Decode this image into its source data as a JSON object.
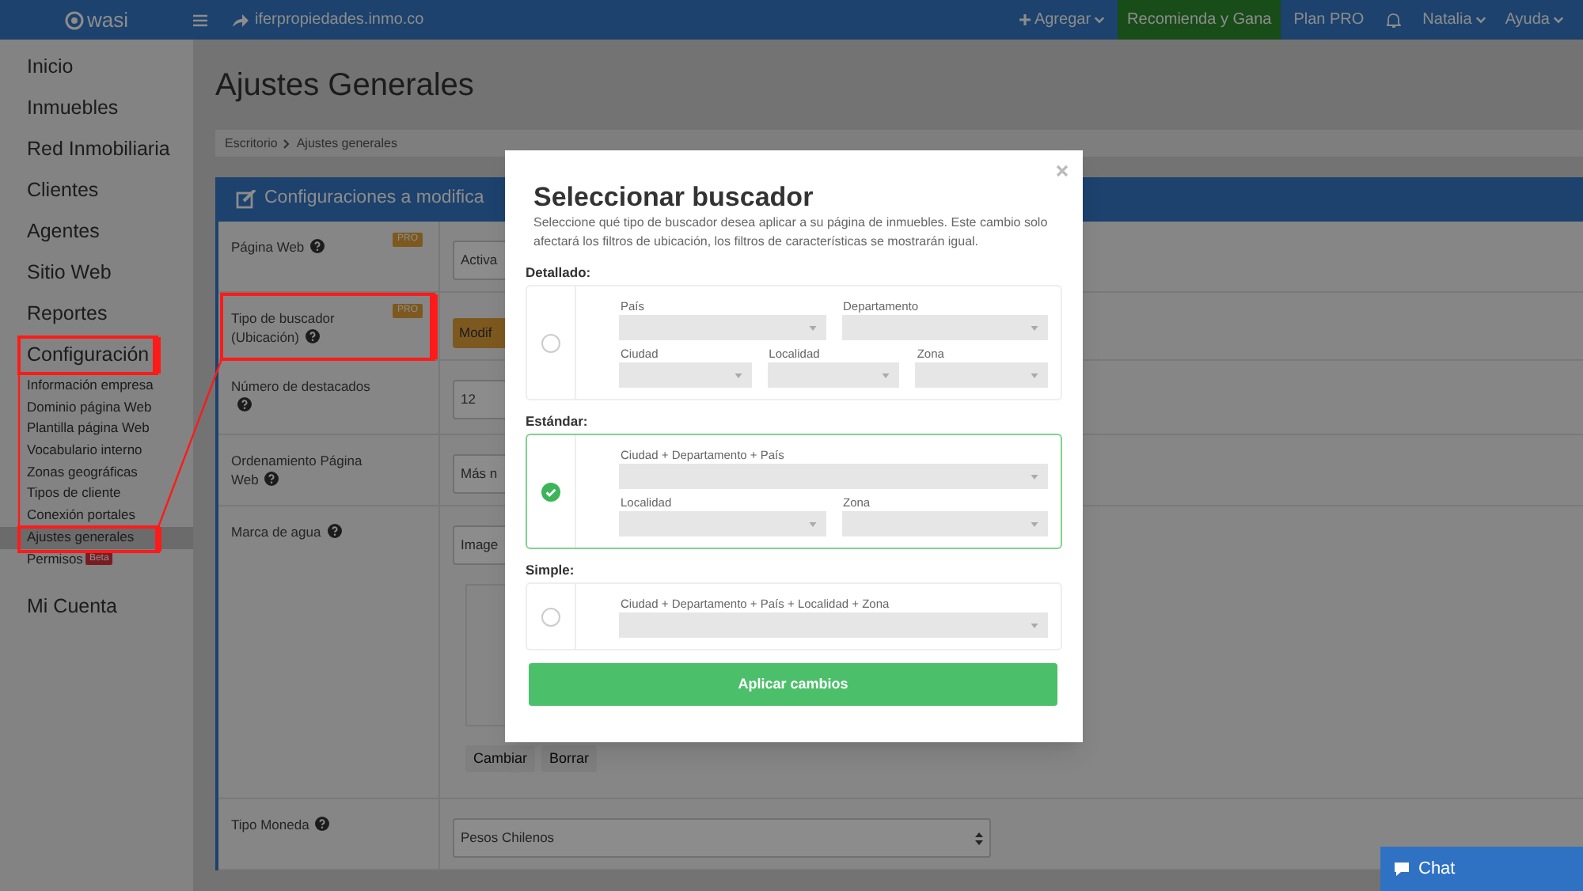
{
  "topbar": {
    "logo": "wasi",
    "url": "iferpropiedades.inmo.co",
    "add": "Agregar",
    "promo": "Recomienda y Gana",
    "plan": "Plan PRO",
    "user": "Natalia",
    "help": "Ayuda"
  },
  "sidebar": {
    "items": [
      {
        "label": "Inicio"
      },
      {
        "label": "Inmuebles"
      },
      {
        "label": "Red Inmobiliaria"
      },
      {
        "label": "Clientes"
      },
      {
        "label": "Agentes"
      },
      {
        "label": "Sitio Web"
      },
      {
        "label": "Reportes"
      },
      {
        "label": "Configuración",
        "children": [
          {
            "label": "Información empresa",
            "selected": false
          },
          {
            "label": "Dominio página Web",
            "selected": false
          },
          {
            "label": "Plantilla página Web",
            "selected": false
          },
          {
            "label": "Vocabulario interno",
            "selected": false
          },
          {
            "label": "Zonas geográficas",
            "selected": false
          },
          {
            "label": "Tipos de cliente",
            "selected": false
          },
          {
            "label": "Conexión portales",
            "selected": false
          },
          {
            "label": "Ajustes generales",
            "selected": true
          },
          {
            "label": "Permisos",
            "selected": false,
            "badge": "Beta"
          }
        ]
      },
      {
        "label": "Mi Cuenta"
      }
    ]
  },
  "page": {
    "title": "Ajustes Generales",
    "breadcrumb": [
      "Escritorio",
      "Ajustes generales"
    ],
    "panel_title": "Configuraciones a modifica",
    "rows": [
      {
        "label": "Página Web",
        "badge": "PRO",
        "kind": "select",
        "value": "Activa"
      },
      {
        "label": "Tipo de buscador (Ubicación)",
        "badge": "PRO",
        "kind": "button",
        "value": "Modif"
      },
      {
        "label": "Número de destacados",
        "kind": "input",
        "value": "12"
      },
      {
        "label": "Ordenamiento Página Web",
        "kind": "select",
        "value": "Más n"
      },
      {
        "label": "Marca de agua",
        "kind": "image",
        "value": "Image",
        "buttons": [
          "Cambiar",
          "Borrar"
        ]
      },
      {
        "label": "Tipo Moneda",
        "kind": "select",
        "value": "Pesos Chilenos"
      }
    ]
  },
  "modal": {
    "title": "Seleccionar buscador",
    "description": "Seleccione qué tipo de buscador desea aplicar a su página de inmuebles. Este cambio solo afectará los filtros de ubicación, los filtros de características se mostrarán igual.",
    "options": [
      {
        "label": "Detallado:",
        "selected": false,
        "rows": [
          [
            "País",
            "Departamento"
          ],
          [
            "Ciudad",
            "Localidad",
            "Zona"
          ]
        ]
      },
      {
        "label": "Estándar:",
        "selected": true,
        "rows": [
          [
            "Ciudad + Departamento + País"
          ],
          [
            "Localidad",
            "Zona"
          ]
        ]
      },
      {
        "label": "Simple:",
        "selected": false,
        "rows": [
          [
            "Ciudad + Departamento + País + Localidad + Zona"
          ]
        ]
      }
    ],
    "button": "Aplicar cambios"
  },
  "chat": "Chat"
}
